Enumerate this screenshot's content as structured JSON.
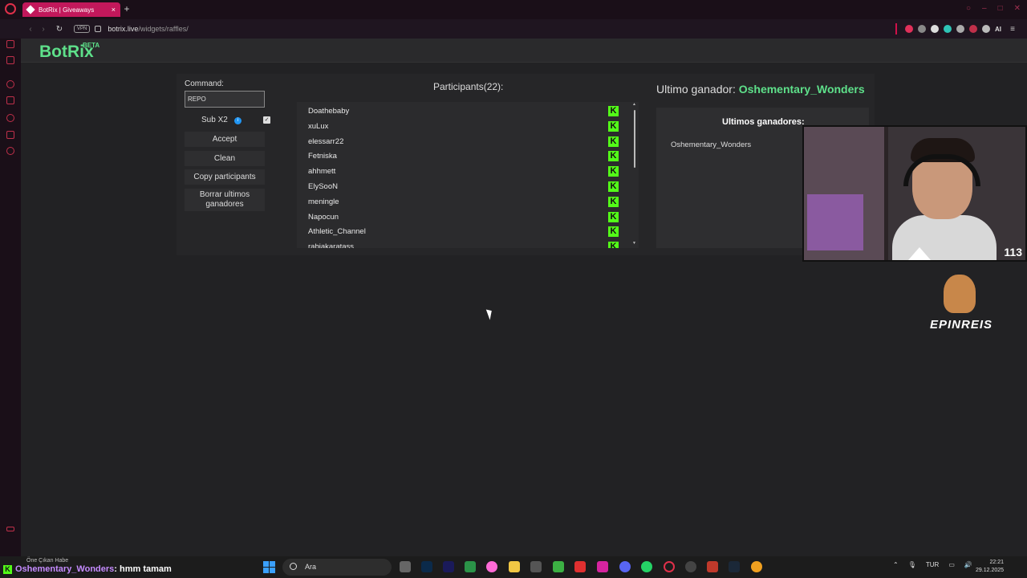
{
  "browser": {
    "tab_title": "BotRix | Giveaways",
    "vpn_label": "VPN",
    "url_host": "botrix.live",
    "url_path": "/widgets/raffles/",
    "ai_label": "AI"
  },
  "app": {
    "logo": "BotRix",
    "beta": "BETA"
  },
  "raffle": {
    "command_label": "Command:",
    "command_value": "REPO",
    "sub_label": "Sub X2",
    "sub_checked": true,
    "buttons": {
      "accept": "Accept",
      "clean": "Clean",
      "copy": "Copy participants",
      "clear_winners": "Borrar ultimos ganadores"
    },
    "participants_title": "Participants(22):",
    "participants": [
      "Doathebaby",
      "xuLux",
      "elessarr22",
      "Fetniska",
      "ahhmett",
      "ElySooN",
      "meningle",
      "Napocun",
      "Athletic_Channel",
      "rabiakaratass"
    ],
    "last_winner_label": "Ultimo ganador:",
    "last_winner": "Oshementary_Wonders",
    "winners_title": "Ultimos ganadores:",
    "winners": [
      "Oshementary_Wonders"
    ]
  },
  "overlay": {
    "viewer_count": "113",
    "sponsor": "EPINREIS",
    "chat_user": "Oshementary_Wonders",
    "chat_message": ": hmm tamam"
  },
  "taskbar": {
    "news": "Öne Çıkan Habe",
    "search_placeholder": "Ara",
    "language": "TUR",
    "time": "22:21",
    "date": "29.12.2025"
  },
  "colors": {
    "accent": "#5ee08a",
    "kick_green": "#53fc18",
    "tab_pink": "#c2185b"
  }
}
